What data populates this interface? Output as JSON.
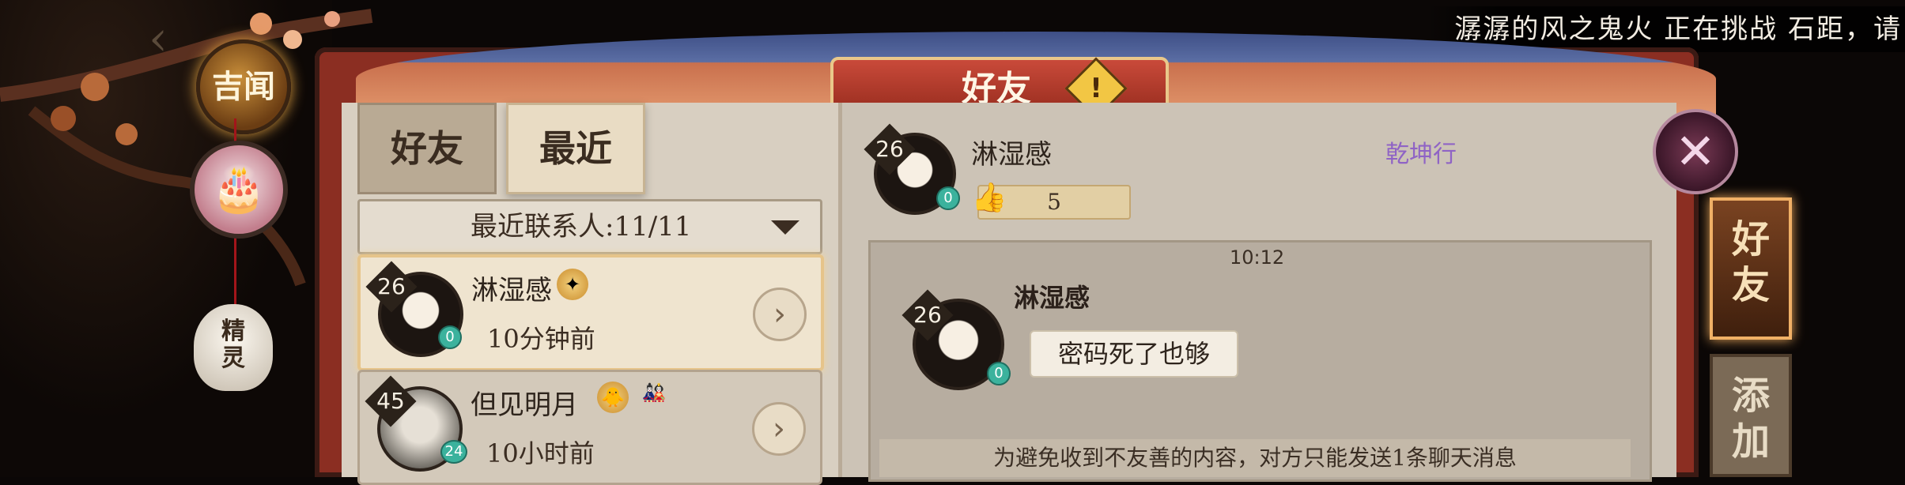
{
  "top_notice": "潺潺的风之鬼火 正在挑战 石距，请",
  "side": {
    "news_label": "吉闻",
    "back_icon": "back-arrow-icon",
    "spirit_label": "精灵"
  },
  "header": {
    "title": "好友",
    "warning_icon": "!"
  },
  "tabs": [
    {
      "label": "好友"
    },
    {
      "label": "最近"
    }
  ],
  "dropdown": {
    "label": "最近联系人:11/11"
  },
  "contacts": [
    {
      "level": "26",
      "name": "淋湿感",
      "time": "10分钟前",
      "badge": "0",
      "selected": true
    },
    {
      "level": "45",
      "name": "但见明月",
      "time": "10小时前",
      "badge": "24",
      "selected": false
    }
  ],
  "profile": {
    "level": "26",
    "name": "淋湿感",
    "guild": "乾坤行",
    "likes": "5",
    "badge": "0"
  },
  "chat": {
    "time": "10:12",
    "sender_level": "26",
    "sender_name": "淋湿感",
    "sender_badge": "0",
    "message": "密码死了也够",
    "notice": "为避免收到不友善的内容，对方只能发送1条聊天消息"
  },
  "side_tabs": [
    {
      "label": "好友",
      "active": true
    },
    {
      "label": "添加",
      "active": false
    }
  ],
  "colors": {
    "accent": "#8b2e22",
    "guild": "#8f63c5",
    "level_badge": "#3bb29d"
  }
}
